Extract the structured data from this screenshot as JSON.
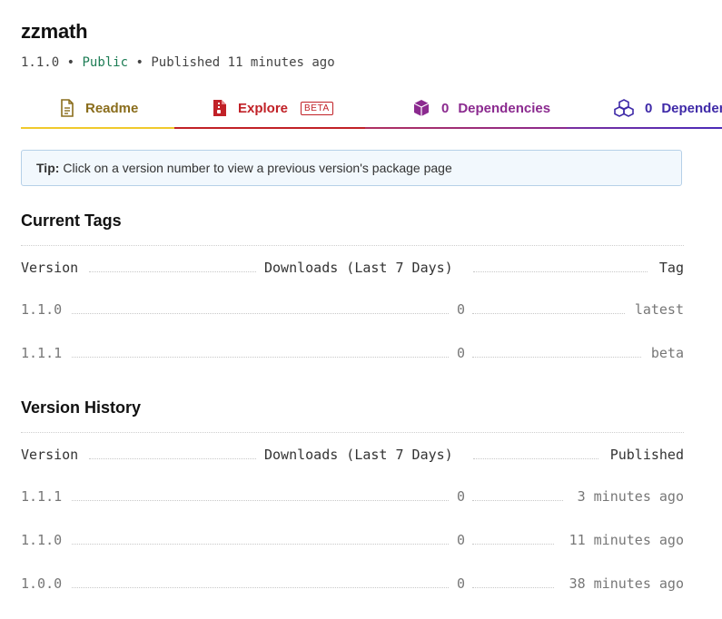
{
  "package": {
    "name": "zzmath",
    "version": "1.1.0",
    "visibility": "Public",
    "published": "Published 11 minutes ago",
    "separator": "•"
  },
  "tabs": [
    {
      "label": "Readme",
      "count": "",
      "icon": "readme-document-icon",
      "color": "#8a6d1c"
    },
    {
      "label": "Explore",
      "count": "",
      "badge": "BETA",
      "icon": "zip-file-icon",
      "color": "#c12127"
    },
    {
      "label": "Dependencies",
      "count": "0",
      "icon": "box-icon",
      "color": "#8b2a8f"
    },
    {
      "label": "Dependents",
      "count": "0",
      "icon": "stacked-boxes-icon",
      "color": "#3f2aa8"
    }
  ],
  "tip": {
    "strong": "Tip:",
    "text": "Click on a version number to view a previous version's package page"
  },
  "current_tags": {
    "title": "Current Tags",
    "headers": {
      "version": "Version",
      "downloads": "Downloads (Last 7 Days)",
      "tag": "Tag"
    },
    "rows": [
      {
        "version": "1.1.0",
        "downloads": "0",
        "tag": "latest"
      },
      {
        "version": "1.1.1",
        "downloads": "0",
        "tag": "beta"
      }
    ]
  },
  "version_history": {
    "title": "Version History",
    "headers": {
      "version": "Version",
      "downloads": "Downloads (Last 7 Days)",
      "published": "Published"
    },
    "rows": [
      {
        "version": "1.1.1",
        "downloads": "0",
        "published": "3 minutes ago"
      },
      {
        "version": "1.1.0",
        "downloads": "0",
        "published": "11 minutes ago"
      },
      {
        "version": "1.0.0",
        "downloads": "0",
        "published": "38 minutes ago"
      }
    ]
  }
}
